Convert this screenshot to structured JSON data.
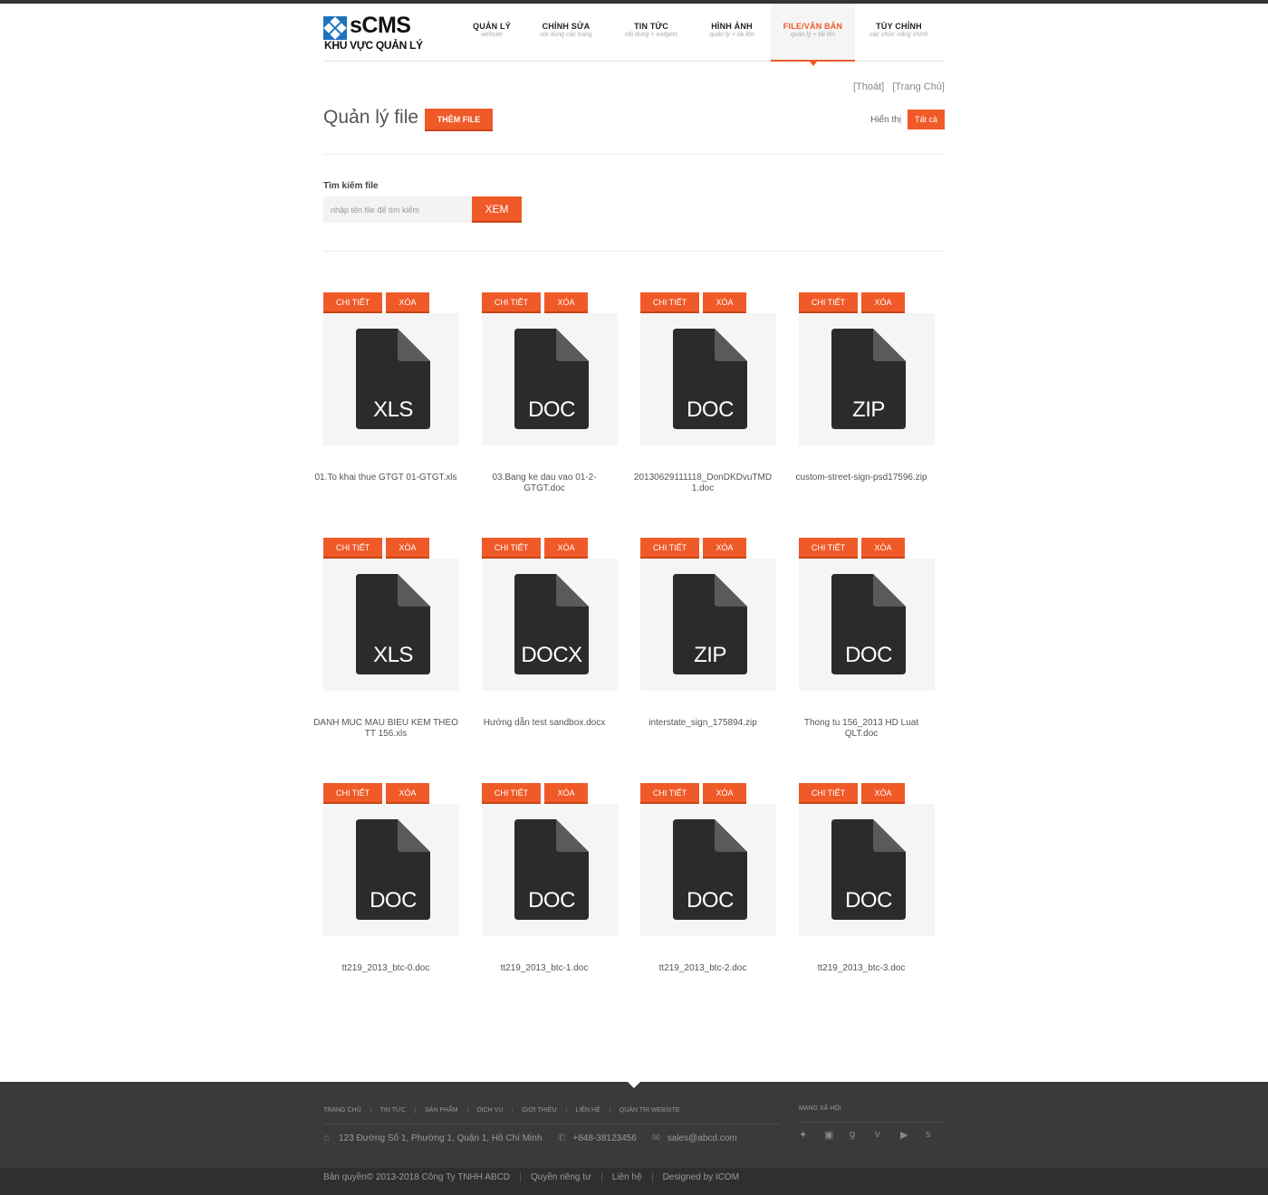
{
  "header": {
    "brand": "sCMS",
    "subtitle": "KHU VỰC QUẢN LÝ",
    "nav": [
      {
        "title": "QUẢN LÝ",
        "sub": "website"
      },
      {
        "title": "CHỈNH SỬA",
        "sub": "nội dung các trang"
      },
      {
        "title": "TIN TỨC",
        "sub": "nội dung + widgets"
      },
      {
        "title": "HÌNH ẢNH",
        "sub": "quản lý + tải lên"
      },
      {
        "title": "FILE/VĂN BẢN",
        "sub": "quản lý + tải lên"
      },
      {
        "title": "TÙY CHỈNH",
        "sub": "các chức năng chính"
      }
    ],
    "active_index": 4,
    "accent_color": "#f05a28"
  },
  "toplinks": {
    "logout": "[Thoát]",
    "home": "[Trang Chủ]"
  },
  "page": {
    "title": "Quản lý file",
    "add_button": "THÊM FILE",
    "show_label": "Hiển thị",
    "show_value": "Tất cả"
  },
  "search": {
    "label": "Tìm kiếm file",
    "placeholder": "nhập tên file để tìm kiếm",
    "button": "XEM"
  },
  "card_actions": {
    "detail": "CHI TIẾT",
    "delete": "XÓA"
  },
  "files": [
    {
      "ext": "XLS",
      "icon": "file-icon",
      "name": "01.To khai thue GTGT 01-GTGT.xls"
    },
    {
      "ext": "DOC",
      "icon": "file-icon",
      "name": "03.Bang ke dau vao 01-2-GTGT.doc"
    },
    {
      "ext": "DOC",
      "icon": "file-icon",
      "name": "20130629111118_DonDKDvuTMD 1.doc"
    },
    {
      "ext": "ZIP",
      "icon": "file-icon",
      "name": "custom-street-sign-psd17596.zip"
    },
    {
      "ext": "XLS",
      "icon": "file-icon",
      "name": "DANH MUC MAU BIEU KEM THEO TT 156.xls"
    },
    {
      "ext": "DOCX",
      "icon": "file-icon",
      "name": "Hướng dẫn test sandbox.docx"
    },
    {
      "ext": "ZIP",
      "icon": "file-icon",
      "name": "interstate_sign_175894.zip"
    },
    {
      "ext": "DOC",
      "icon": "file-icon",
      "name": "Thong tu 156_2013 HD Luat QLT.doc"
    },
    {
      "ext": "DOC",
      "icon": "file-icon",
      "name": "tt219_2013_btc-0.doc"
    },
    {
      "ext": "DOC",
      "icon": "file-icon",
      "name": "tt219_2013_btc-1.doc"
    },
    {
      "ext": "DOC",
      "icon": "file-icon",
      "name": "tt219_2013_btc-2.doc"
    },
    {
      "ext": "DOC",
      "icon": "file-icon",
      "name": "tt219_2013_btc-3.doc"
    }
  ],
  "footer": {
    "nav": [
      "TRANG CHỦ",
      "TIN TỨC",
      "SẢN PHẨM",
      "DỊCH VỤ",
      "GIỚI THIỆU",
      "LIÊN HỆ",
      "QUẢN TRỊ WEBSITE"
    ],
    "address": "123 Đường Số 1, Phường 1, Quận 1, Hồ Chí Minh",
    "phone": "+848-38123456",
    "email": "sales@abcd.com",
    "social_title": "MẠNG XÃ HỘI",
    "social": [
      "twitter-icon",
      "facebook-icon",
      "google-plus-icon",
      "vimeo-icon",
      "youtube-icon",
      "skype-icon"
    ],
    "copyright": "Bản quyền© 2013-2018 Công Ty TNHH ABCD",
    "privacy": "Quyền riêng tư",
    "contact": "Liên hệ",
    "designer": "Designed by ICOM"
  }
}
